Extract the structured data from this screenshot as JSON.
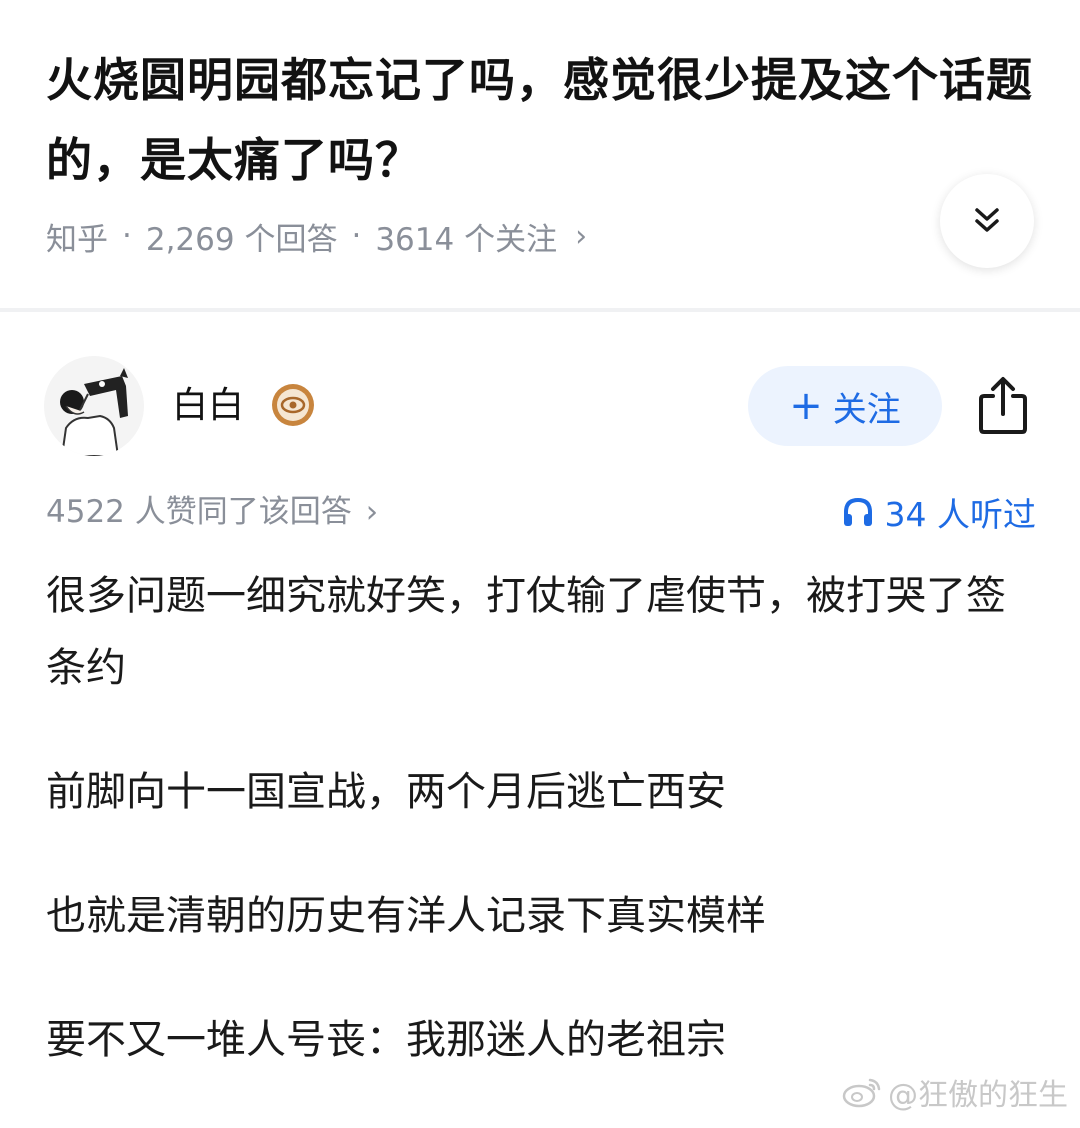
{
  "question": {
    "title": "火烧圆明园都忘记了吗，感觉很少提及这个话题的，是太痛了吗？",
    "source": "知乎",
    "answer_count": "2,269 个回答",
    "follow_count": "3614 个关注"
  },
  "author": {
    "name": "白白",
    "follow_label": "关注"
  },
  "stats": {
    "votes": "4522 人赞同了该回答",
    "listens": "34 人听过"
  },
  "answer": {
    "paragraphs": [
      "很多问题一细究就好笑，打仗输了虐使节，被打哭了签条约",
      "前脚向十一国宣战，两个月后逃亡西安",
      "也就是清朝的历史有洋人记录下真实模样",
      "要不又一堆人号丧：我那迷人的老祖宗"
    ]
  },
  "watermark": "@狂傲的狂生",
  "icons": {
    "expand": "double-chevron-down-icon",
    "badge": "eye-badge-icon",
    "share": "share-icon",
    "listen": "headphones-icon",
    "watermark": "weibo-logo-icon"
  },
  "colors": {
    "accent": "#1e6be4",
    "meta": "#8a8f99",
    "follow_bg": "#ecf3fe",
    "badge": "#c8853e"
  }
}
